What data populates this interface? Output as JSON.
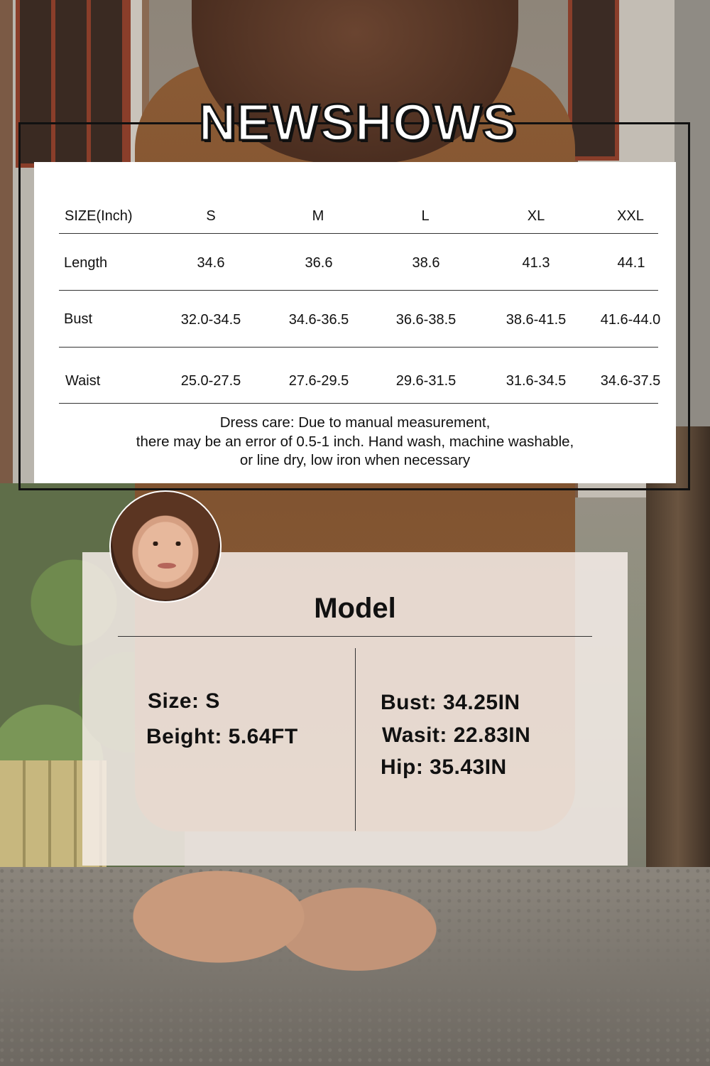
{
  "brand": "NEWSHOWS",
  "size_table": {
    "headers": [
      "SIZE(Inch)",
      "S",
      "M",
      "L",
      "XL",
      "XXL"
    ],
    "rows": [
      {
        "label": "Length",
        "values": [
          "34.6",
          "36.6",
          "38.6",
          "41.3",
          "44.1"
        ]
      },
      {
        "label": "Bust",
        "values": [
          "32.0-34.5",
          "34.6-36.5",
          "36.6-38.5",
          "38.6-41.5",
          "41.6-44.0"
        ]
      },
      {
        "label": "Waist",
        "values": [
          "25.0-27.5",
          "27.6-29.5",
          "29.6-31.5",
          "31.6-34.5",
          "34.6-37.5"
        ]
      }
    ],
    "note_lines": [
      "Dress care: Due to manual measurement,",
      "there may be an error of 0.5-1 inch. Hand wash, machine washable,",
      "or line dry, low iron when necessary"
    ]
  },
  "model": {
    "title": "Model",
    "left": [
      "Size: S",
      "Beight: 5.64FT"
    ],
    "right": [
      "Bust: 34.25IN",
      "Wasit: 22.83IN",
      "Hip: 35.43IN"
    ]
  },
  "colors": {
    "dress": "#8a5a34",
    "panel": "#f6eee9",
    "text": "#111111"
  }
}
